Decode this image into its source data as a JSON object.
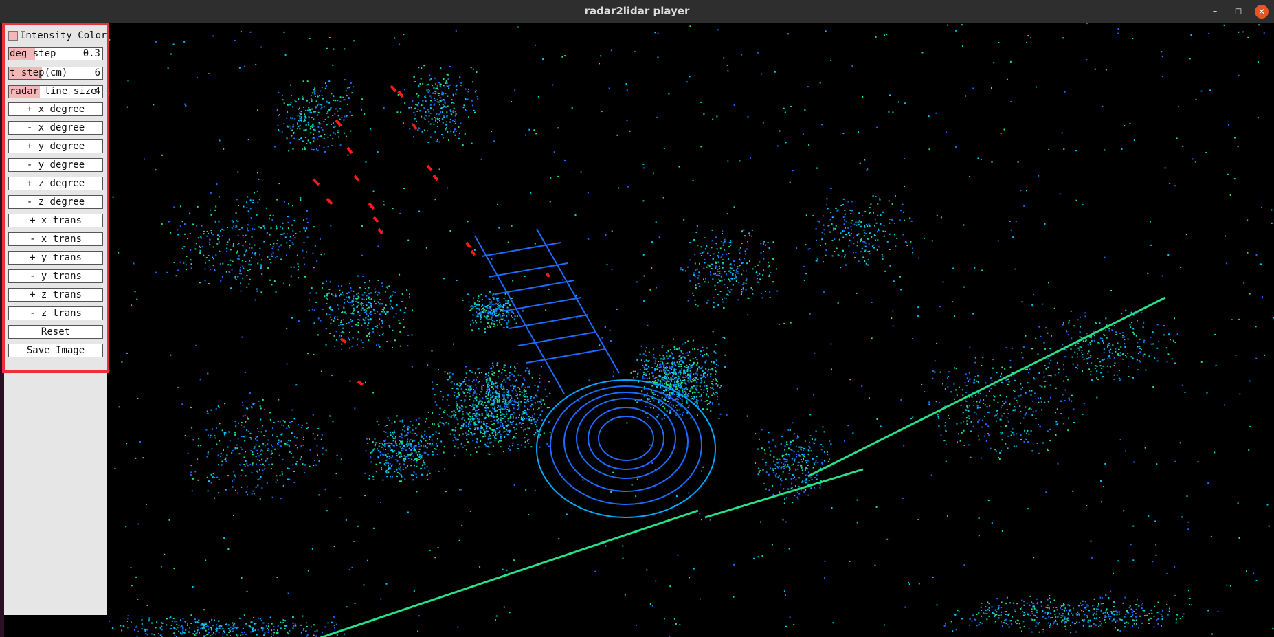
{
  "window": {
    "title": "radar2lidar player",
    "minimize_glyph": "–",
    "maximize_glyph": "◻",
    "close_glyph": "✕"
  },
  "panel": {
    "intensity_color": {
      "label": "Intensity Color",
      "checked": false
    },
    "sliders": [
      {
        "label": "deg step",
        "value": "0.3",
        "fill_fraction": 0.28
      },
      {
        "label": "t step(cm)",
        "value": "6",
        "fill_fraction": 0.35
      },
      {
        "label": "radar line size",
        "value": "4",
        "fill_fraction": 0.33
      }
    ],
    "buttons": [
      "+ x degree",
      "- x degree",
      "+ y degree",
      "- y degree",
      "+ z degree",
      "- z degree",
      "+ x trans",
      "- x trans",
      "+ y trans",
      "- y trans",
      "+ z trans",
      "- z trans",
      "Reset",
      "Save Image"
    ]
  },
  "colors": {
    "panel_bg": "#e6e6e6",
    "slider_fill": "#f4b6b6",
    "highlight_border": "#e8313a",
    "lidar_primary": "#1e6bff",
    "lidar_secondary": "#00c8ff",
    "lidar_tertiary": "#29e08a",
    "radar_points": "#ff1a1a"
  }
}
